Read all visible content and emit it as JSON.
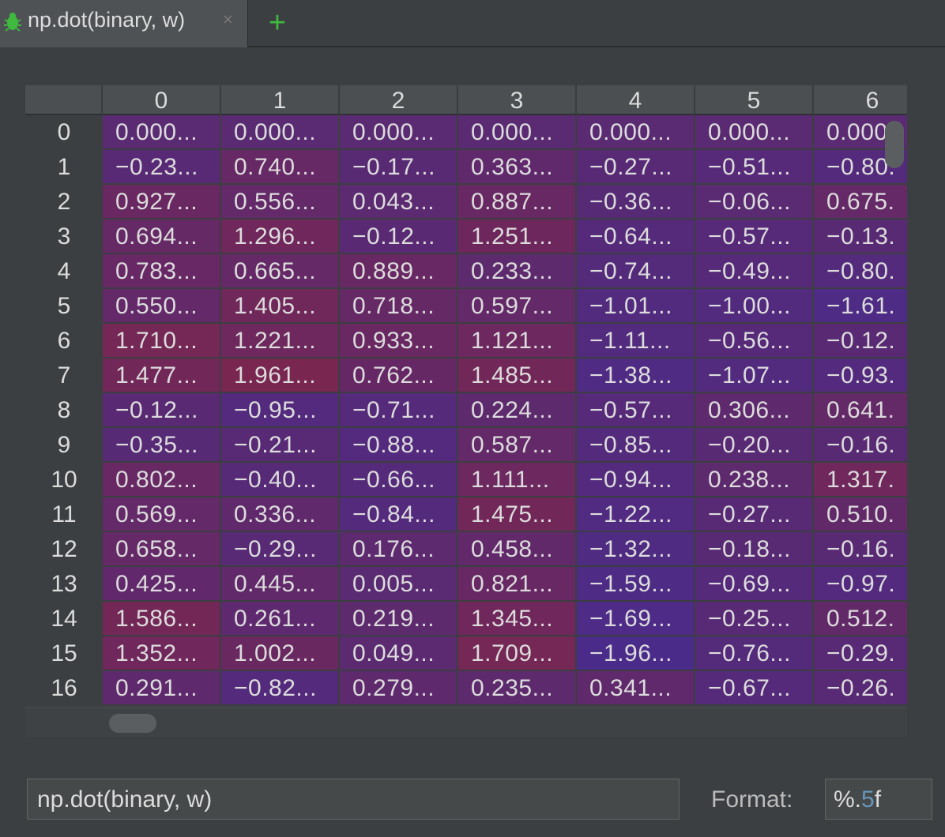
{
  "tab": {
    "title": "np.dot(binary, w)",
    "close_glyph": "×",
    "icon": "bug-icon",
    "add_glyph": "+"
  },
  "table": {
    "columns": [
      "0",
      "1",
      "2",
      "3",
      "4",
      "5",
      "6"
    ],
    "rows": [
      {
        "index": "0",
        "cells": [
          "0.000...",
          "0.000...",
          "0.000...",
          "0.000...",
          "0.000...",
          "0.000...",
          "0.000."
        ]
      },
      {
        "index": "1",
        "cells": [
          "−0.23...",
          "0.740...",
          "−0.17...",
          "0.363...",
          "−0.27...",
          "−0.51...",
          "−0.80."
        ]
      },
      {
        "index": "2",
        "cells": [
          "0.927...",
          "0.556...",
          "0.043...",
          "0.887...",
          "−0.36...",
          "−0.06...",
          "0.675."
        ]
      },
      {
        "index": "3",
        "cells": [
          "0.694...",
          "1.296...",
          "−0.12...",
          "1.251...",
          "−0.64...",
          "−0.57...",
          "−0.13."
        ]
      },
      {
        "index": "4",
        "cells": [
          "0.783...",
          "0.665...",
          "0.889...",
          "0.233...",
          "−0.74...",
          "−0.49...",
          "−0.80."
        ]
      },
      {
        "index": "5",
        "cells": [
          "0.550...",
          "1.405...",
          "0.718...",
          "0.597...",
          "−1.01...",
          "−1.00...",
          "−1.61."
        ]
      },
      {
        "index": "6",
        "cells": [
          "1.710...",
          "1.221...",
          "0.933...",
          "1.121...",
          "−1.11...",
          "−0.56...",
          "−0.12."
        ]
      },
      {
        "index": "7",
        "cells": [
          "1.477...",
          "1.961...",
          "0.762...",
          "1.485...",
          "−1.38...",
          "−1.07...",
          "−0.93."
        ]
      },
      {
        "index": "8",
        "cells": [
          "−0.12...",
          "−0.95...",
          "−0.71...",
          "0.224...",
          "−0.57...",
          "0.306...",
          "0.641."
        ]
      },
      {
        "index": "9",
        "cells": [
          "−0.35...",
          "−0.21...",
          "−0.88...",
          "0.587...",
          "−0.85...",
          "−0.20...",
          "−0.16."
        ]
      },
      {
        "index": "10",
        "cells": [
          "0.802...",
          "−0.40...",
          "−0.66...",
          "1.111...",
          "−0.94...",
          "0.238...",
          "1.317."
        ]
      },
      {
        "index": "11",
        "cells": [
          "0.569...",
          "0.336...",
          "−0.84...",
          "1.475...",
          "−1.22...",
          "−0.27...",
          "0.510."
        ]
      },
      {
        "index": "12",
        "cells": [
          "0.658...",
          "−0.29...",
          "0.176...",
          "0.458...",
          "−1.32...",
          "−0.18...",
          "−0.16."
        ]
      },
      {
        "index": "13",
        "cells": [
          "0.425...",
          "0.445...",
          "0.005...",
          "0.821...",
          "−1.59...",
          "−0.69...",
          "−0.97."
        ]
      },
      {
        "index": "14",
        "cells": [
          "1.586...",
          "0.261...",
          "0.219...",
          "1.345...",
          "−1.69...",
          "−0.25...",
          "0.512."
        ]
      },
      {
        "index": "15",
        "cells": [
          "1.352...",
          "1.002...",
          "0.049...",
          "1.709...",
          "−1.96...",
          "−0.76...",
          "−0.29."
        ]
      },
      {
        "index": "16",
        "cells": [
          "0.291...",
          "−0.82...",
          "0.279...",
          "0.235...",
          "0.341...",
          "−0.67...",
          "−0.26."
        ]
      }
    ],
    "colors": {
      "low": "#4b2b8a",
      "mid": "#5a2a72",
      "high": "#7a2650"
    }
  },
  "bottom": {
    "expression": "np.dot(binary, w)",
    "format_label": "Format:",
    "format_prefix": "%.",
    "format_number": "5",
    "format_suffix": "f"
  }
}
